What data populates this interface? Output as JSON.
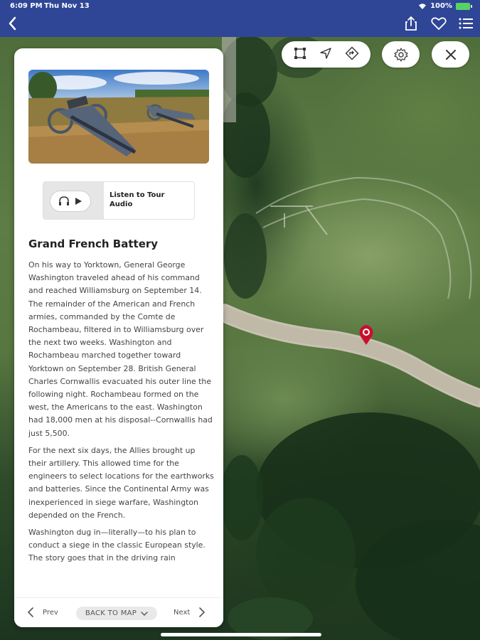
{
  "status_bar": {
    "time": "6:09 PM",
    "date": "Thu Nov 13",
    "battery": "100%"
  },
  "nav": {
    "back_icon": "chevron-left-icon",
    "actions": [
      "share-icon",
      "heart-icon",
      "list-icon"
    ]
  },
  "map_tools": {
    "tools": [
      "crop-icon",
      "location-arrow-icon",
      "directions-icon"
    ],
    "settings_icon": "gear-icon",
    "close_icon": "close-icon"
  },
  "card": {
    "audio": {
      "label": "Listen to Tour Audio"
    },
    "title": "Grand French Battery",
    "paragraphs": [
      "On his way to Yorktown, General George Washington traveled ahead of his command and reached Williamsburg on September 14. The remainder of the American and French armies, commanded by the Comte de Rochambeau, filtered in to Williamsburg over the next two weeks. Washington and Rochambeau marched together toward Yorktown on September 28. British General Charles Cornwallis evacuated his outer line the following night. Rochambeau formed on the west, the Americans to the east. Washington had 18,000 men at his disposal--Cornwallis had just 5,500.",
      "For the next six days, the Allies brought up their artillery. This allowed time for the engineers to select locations for the earthworks and batteries. Since the Continental Army was inexperienced in siege warfare, Washington depended on the French.",
      "Washington dug in—literally—to his plan to conduct a siege in the classic European style. The story goes that in the driving rain"
    ],
    "footer": {
      "prev": "Prev",
      "back_to_map": "BACK TO MAP",
      "next": "Next"
    }
  },
  "colors": {
    "nav_bg": "#2f4596",
    "marker": "#c8102e",
    "card_bg": "#ffffff"
  }
}
